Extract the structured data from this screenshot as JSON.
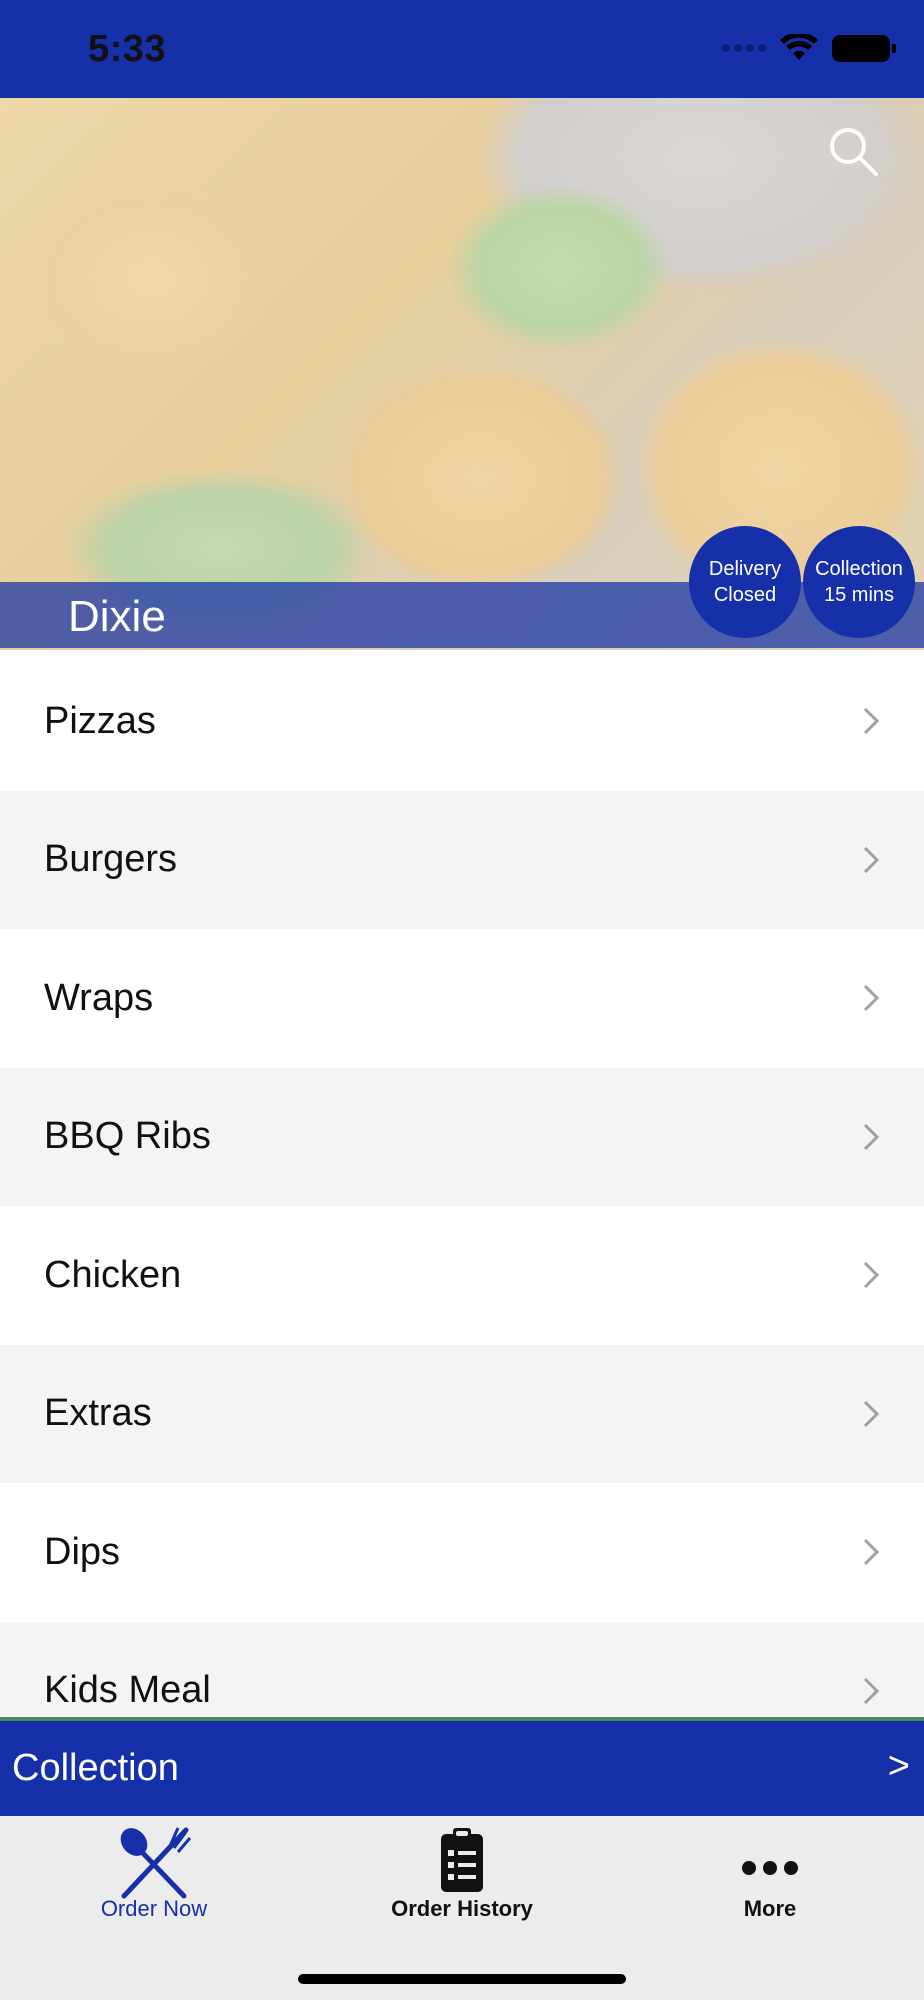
{
  "status_bar": {
    "time": "5:33"
  },
  "header": {
    "restaurant_name": "Dixie",
    "delivery_badge": {
      "line1": "Delivery",
      "line2": "Closed"
    },
    "collection_badge": {
      "line1": "Collection",
      "line2": "15 mins"
    },
    "search_icon": "search-icon"
  },
  "menu": {
    "categories": [
      {
        "label": "Pizzas"
      },
      {
        "label": "Burgers"
      },
      {
        "label": "Wraps"
      },
      {
        "label": "BBQ Ribs"
      },
      {
        "label": "Chicken"
      },
      {
        "label": "Extras"
      },
      {
        "label": "Dips"
      },
      {
        "label": "Kids Meal"
      }
    ]
  },
  "collection_bar": {
    "label": "Collection",
    "arrow": ">"
  },
  "tab_bar": {
    "tabs": [
      {
        "label": "Order Now",
        "icon": "fork-knife-icon",
        "active": true
      },
      {
        "label": "Order History",
        "icon": "clipboard-icon",
        "active": false
      },
      {
        "label": "More",
        "icon": "more-dots-icon",
        "active": false
      }
    ]
  },
  "colors": {
    "brand_blue": "#1530a8",
    "row_alt": "#f3f4f6",
    "tab_bar_bg": "#ececec"
  }
}
